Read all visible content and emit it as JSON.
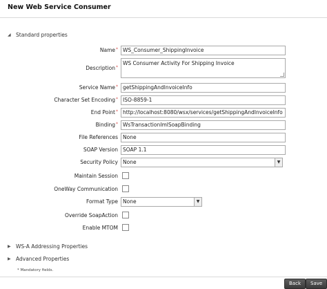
{
  "header": {
    "title": "New Web Service Consumer"
  },
  "sections": {
    "standard": "Standard properties",
    "wsa": "WS-A Addressing Properties",
    "advanced": "Advanced Properties"
  },
  "fields": {
    "name": {
      "label": "Name",
      "value": "WS_Consumer_ShippingInvoice",
      "required": "*"
    },
    "description": {
      "label": "Description",
      "value": "WS Consumer Activity For Shipping Invoice",
      "required": "*"
    },
    "service_name": {
      "label": "Service Name",
      "value": "getShippingAndInvoiceInfo",
      "required": "*"
    },
    "charset": {
      "label": "Character Set Encoding",
      "value": "ISO-8859-1",
      "required": "*"
    },
    "end_point": {
      "label": "End Point",
      "value": "http://localhost:8080/wsx/services/getShippingAndInvoiceInfo",
      "required": "*"
    },
    "binding": {
      "label": "Binding",
      "value": "WsTransactionImlSoapBinding",
      "required": "*"
    },
    "file_references": {
      "label": "File References",
      "value": "None"
    },
    "soap_version": {
      "label": "SOAP Version",
      "value": "SOAP 1.1"
    },
    "security_policy": {
      "label": "Security Policy",
      "value": "None"
    },
    "maintain_session": {
      "label": "Maintain Session"
    },
    "oneway": {
      "label": "OneWay Communication"
    },
    "format_type": {
      "label": "Format Type",
      "value": "None"
    },
    "override_soapaction": {
      "label": "Override SoapAction"
    },
    "enable_mtom": {
      "label": "Enable MTOM"
    }
  },
  "mandatory_note": "* Mandatory fields.",
  "buttons": {
    "back": "Back",
    "save": "Save"
  },
  "icons": {
    "expanded": "triangle-down-icon",
    "collapsed": "triangle-right-icon"
  }
}
